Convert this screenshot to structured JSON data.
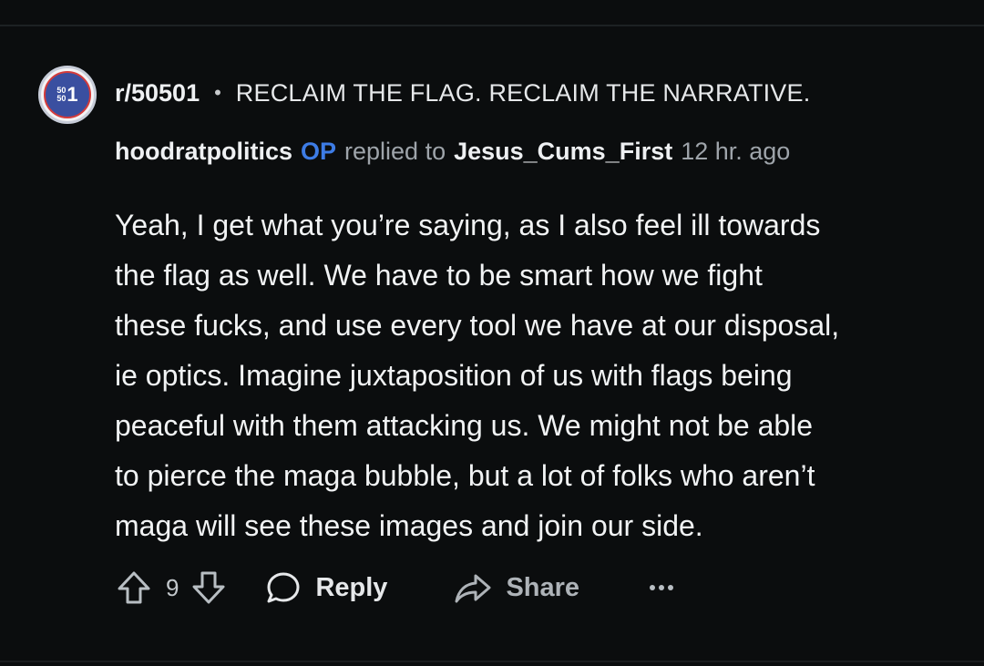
{
  "community": {
    "name": "r/50501",
    "separator": "•",
    "tagline": "RECLAIM THE FLAG. RECLAIM THE NARRATIVE.",
    "avatar_text_top": "50",
    "avatar_text_bottom": "50",
    "avatar_text_big": "1"
  },
  "comment": {
    "author": "hoodratpolitics",
    "op_badge": "OP",
    "replied_to_label": "replied to",
    "parent_author": "Jesus_Cums_First",
    "timestamp": "12 hr. ago",
    "body_lines": [
      "Yeah, I get what you’re saying, as I also feel ill towards",
      "the flag as well. We have to be smart how we fight",
      "these fucks, and use every tool we have at our disposal,",
      "ie optics. Imagine juxtaposition of us with flags being",
      "peaceful with them attacking us. We might not be able",
      "to pierce the maga bubble, but a lot of folks who aren’t",
      "maga will see these images and join our side."
    ]
  },
  "actions": {
    "vote_count": "9",
    "reply_label": "Reply",
    "share_label": "Share",
    "upvote_icon": "arrow-up-outline",
    "downvote_icon": "arrow-down-outline",
    "reply_icon": "speech-bubble",
    "share_icon": "share-arrow",
    "more_icon": "ellipsis"
  },
  "colors": {
    "background": "#0b0d0e",
    "text_primary": "#f1f3f4",
    "text_muted": "#9ea4aa",
    "op_badge": "#3d7ce6"
  }
}
